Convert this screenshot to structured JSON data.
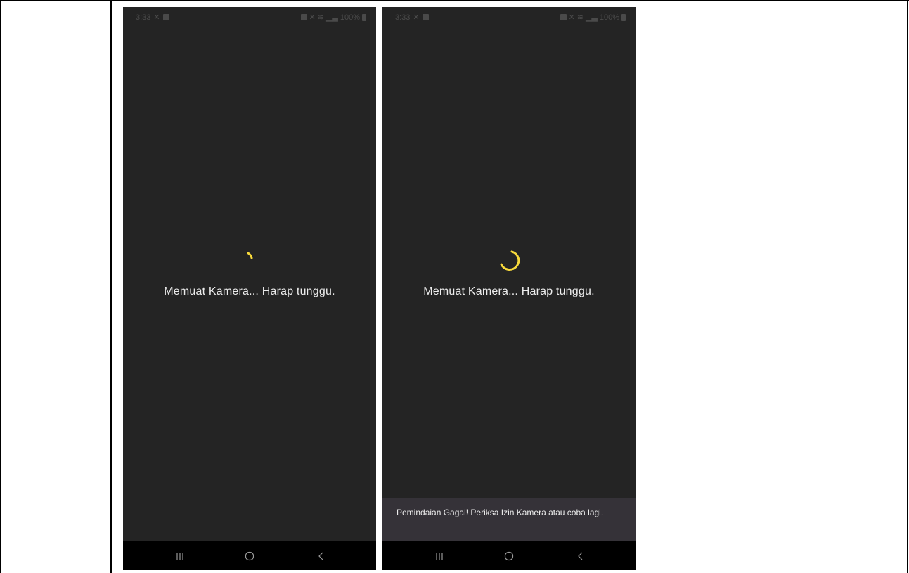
{
  "screens": [
    {
      "status": {
        "time": "3:33",
        "battery": "100%"
      },
      "loading_text": "Memuat Kamera... Harap tunggu."
    },
    {
      "status": {
        "time": "3:33",
        "battery": "100%"
      },
      "loading_text": "Memuat Kamera... Harap tunggu.",
      "snackbar": "Pemindaian Gagal! Periksa Izin Kamera atau coba lagi."
    }
  ],
  "colors": {
    "screen_background": "#242424",
    "spinner": "#f7d93b",
    "snackbar_background": "#353238",
    "nav_background": "#000000",
    "text": "#ececec"
  }
}
